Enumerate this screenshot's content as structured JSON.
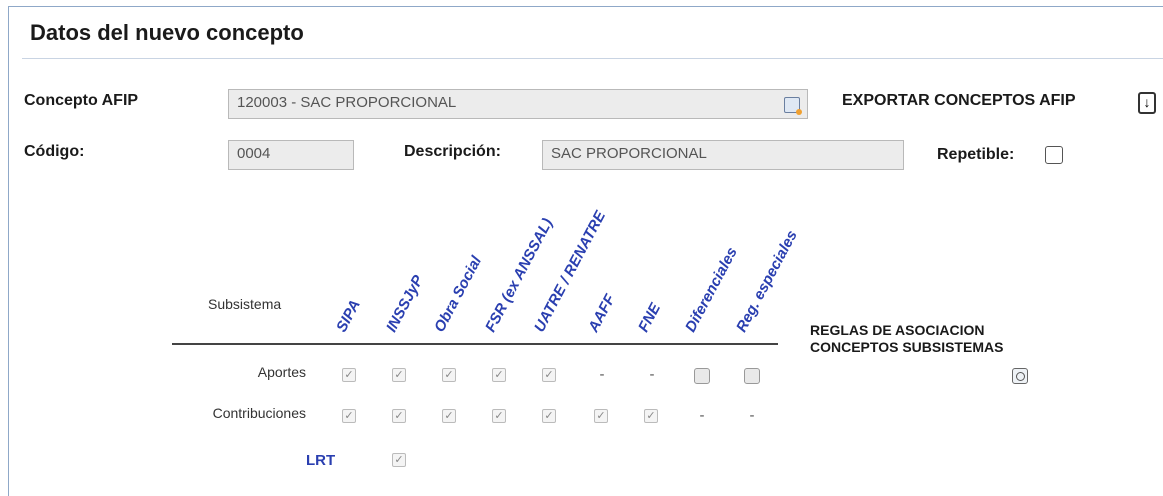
{
  "panel": {
    "title": "Datos del nuevo concepto"
  },
  "form": {
    "concepto_afip_label": "Concepto AFIP",
    "concepto_afip_value": "120003 - SAC PROPORCIONAL",
    "export_label": "EXPORTAR CONCEPTOS AFIP",
    "codigo_label": "Código:",
    "codigo_value": "0004",
    "descripcion_label": "Descripción:",
    "descripcion_value": "SAC PROPORCIONAL",
    "repetible_label": "Repetible:",
    "repetible_checked": false
  },
  "grid": {
    "subsistema_label": "Subsistema",
    "columns": [
      "SIPA",
      "INSSJyP",
      "Obra Social",
      "FSR (ex ANSSAL)",
      "UATRE / RENATRE",
      "AAFF",
      "FNE",
      "Diferenciales",
      "Reg. especiales"
    ],
    "rows": [
      {
        "label": "Aportes",
        "cells": [
          "check",
          "check",
          "check",
          "check",
          "check",
          "-",
          "-",
          "box",
          "box"
        ]
      },
      {
        "label": "Contribuciones",
        "cells": [
          "check",
          "check",
          "check",
          "check",
          "check",
          "check",
          "check",
          "-",
          "-"
        ]
      },
      {
        "label": "LRT",
        "cells": [
          "",
          "check",
          "",
          "",
          "",
          "",
          "",
          "",
          ""
        ]
      }
    ],
    "reglas_label": "REGLAS DE ASOCIACION CONCEPTOS SUBSISTEMAS"
  }
}
